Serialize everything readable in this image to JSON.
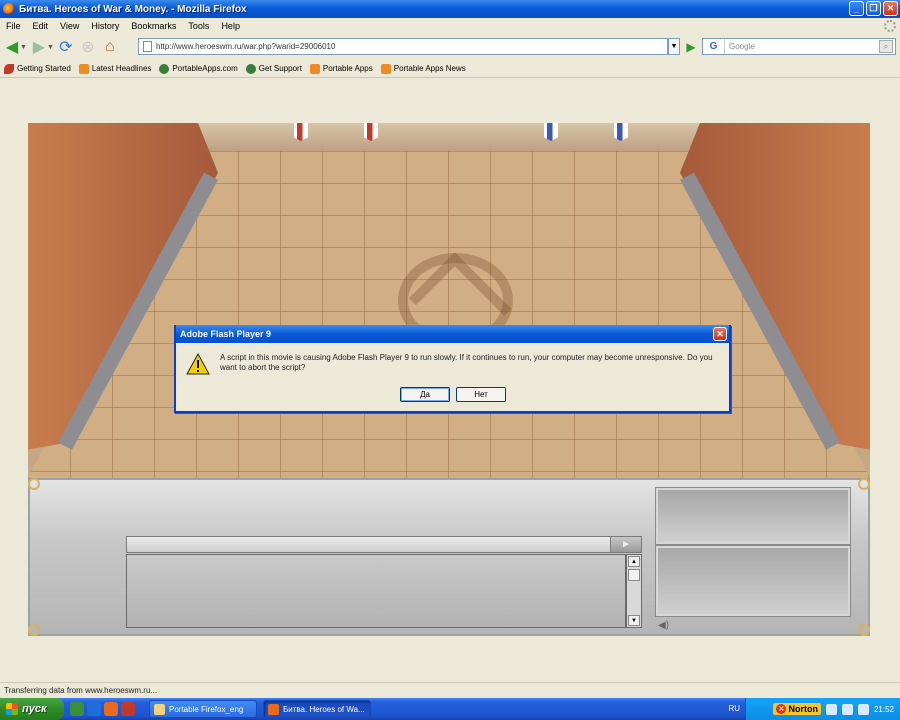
{
  "window": {
    "title": "Битва. Heroes of War & Money. - Mozilla Firefox",
    "buttons": [
      "_",
      "❐",
      "✕"
    ]
  },
  "menu": [
    "File",
    "Edit",
    "View",
    "History",
    "Bookmarks",
    "Tools",
    "Help"
  ],
  "nav": {
    "url": "http://www.heroeswm.ru/war.php?warid=29006010",
    "search_placeholder": "Google",
    "search_engine": "G"
  },
  "bookmarks": [
    {
      "label": "Getting Started",
      "icon": "leaf-icon"
    },
    {
      "label": "Latest Headlines",
      "icon": "rss-icon"
    },
    {
      "label": "PortableApps.com",
      "icon": "globe-icon"
    },
    {
      "label": "Get Support",
      "icon": "globe-icon"
    },
    {
      "label": "Portable Apps",
      "icon": "rss-icon"
    },
    {
      "label": "Portable Apps News",
      "icon": "rss-icon"
    }
  ],
  "dialog": {
    "title": "Adobe Flash Player 9",
    "message": "A script in this movie is causing Adobe Flash Player 9 to run slowly. If it continues to run, your computer may become unresponsive. Do you want to abort the script?",
    "yes_label": "Да",
    "no_label": "Нет",
    "icon": "warning-icon"
  },
  "game": {
    "send_label": "►"
  },
  "status": {
    "text": "Transferring data from www.heroeswm.ru..."
  },
  "taskbar": {
    "start_label": "пуск",
    "tasks": [
      {
        "label": "Portable Firefox_eng"
      },
      {
        "label": "Битва. Heroes of Wa..."
      }
    ],
    "language": "RU",
    "norton_label": "Norton",
    "clock": "21:52"
  }
}
